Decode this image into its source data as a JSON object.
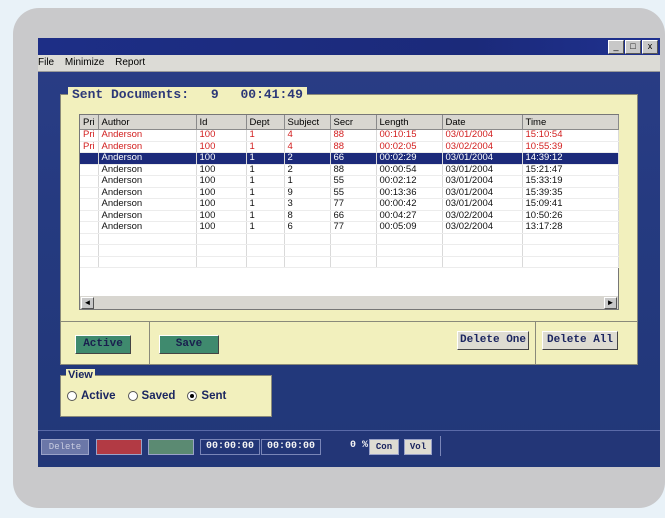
{
  "window": {
    "minimize_glyph": "_",
    "restore_glyph": "□",
    "close_glyph": "x"
  },
  "menu": [
    "File",
    "Minimize",
    "Report"
  ],
  "panel": {
    "title": "Sent Documents:",
    "count": "9",
    "elapsed": "00:41:49"
  },
  "grid": {
    "columns": [
      "Pri",
      "Author",
      "Id",
      "Dept",
      "Subject",
      "Secr",
      "Length",
      "Date",
      "Time"
    ],
    "rows": [
      {
        "pri": "Pri",
        "author": "Anderson",
        "id": "100",
        "dept": "1",
        "subject": "4",
        "secr": "88",
        "length": "00:10:15",
        "date": "03/01/2004",
        "time": "15:10:54",
        "state": "red"
      },
      {
        "pri": "Pri",
        "author": "Anderson",
        "id": "100",
        "dept": "1",
        "subject": "4",
        "secr": "88",
        "length": "00:02:05",
        "date": "03/02/2004",
        "time": "10:55:39",
        "state": "red"
      },
      {
        "pri": "",
        "author": "Anderson",
        "id": "100",
        "dept": "1",
        "subject": "2",
        "secr": "66",
        "length": "00:02:29",
        "date": "03/01/2004",
        "time": "14:39:12",
        "state": "selected"
      },
      {
        "pri": "",
        "author": "Anderson",
        "id": "100",
        "dept": "1",
        "subject": "2",
        "secr": "88",
        "length": "00:00:54",
        "date": "03/01/2004",
        "time": "15:21:47",
        "state": "normal"
      },
      {
        "pri": "",
        "author": "Anderson",
        "id": "100",
        "dept": "1",
        "subject": "1",
        "secr": "55",
        "length": "00:02:12",
        "date": "03/01/2004",
        "time": "15:33:19",
        "state": "normal"
      },
      {
        "pri": "",
        "author": "Anderson",
        "id": "100",
        "dept": "1",
        "subject": "9",
        "secr": "55",
        "length": "00:13:36",
        "date": "03/01/2004",
        "time": "15:39:35",
        "state": "normal"
      },
      {
        "pri": "",
        "author": "Anderson",
        "id": "100",
        "dept": "1",
        "subject": "3",
        "secr": "77",
        "length": "00:00:42",
        "date": "03/01/2004",
        "time": "15:09:41",
        "state": "normal"
      },
      {
        "pri": "",
        "author": "Anderson",
        "id": "100",
        "dept": "1",
        "subject": "8",
        "secr": "66",
        "length": "00:04:27",
        "date": "03/02/2004",
        "time": "10:50:26",
        "state": "normal"
      },
      {
        "pri": "",
        "author": "Anderson",
        "id": "100",
        "dept": "1",
        "subject": "6",
        "secr": "77",
        "length": "00:05:09",
        "date": "03/02/2004",
        "time": "13:17:28",
        "state": "normal"
      }
    ],
    "empty_rows": 3,
    "scroll_left": "◄",
    "scroll_right": "►"
  },
  "buttons": {
    "active": "Active",
    "save": "Save",
    "delete_one": "Delete One",
    "delete_all": "Delete All"
  },
  "view": {
    "legend": "View",
    "options": [
      "Active",
      "Saved",
      "Sent"
    ],
    "selected": "Sent"
  },
  "status": {
    "delete": "Delete",
    "time1": "00:00:00",
    "time2": "00:00:00",
    "percent": "0 %",
    "con": "Con",
    "vol": "Vol"
  },
  "colors": {
    "screen_bg": "#253a80",
    "panel_bg": "#f2f0bd",
    "highlight": "#1c2a7a",
    "priority_text": "#d21e1e",
    "active_button": "#3f8a6e"
  }
}
